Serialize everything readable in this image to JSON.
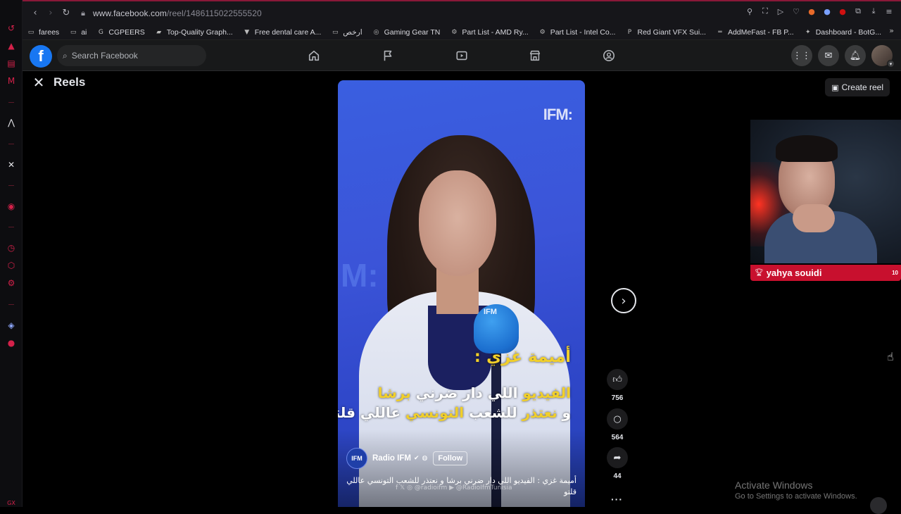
{
  "browser": {
    "url_host": "www.facebook.com",
    "url_path": "/reel/1486115022555520",
    "bookmarks": [
      {
        "icon": "folder-icon",
        "label": "farees"
      },
      {
        "icon": "folder-icon",
        "label": "ai"
      },
      {
        "icon": "cgpeers-icon",
        "label": "CGPEERS"
      },
      {
        "icon": "graphics-icon",
        "label": "Top-Quality Graph..."
      },
      {
        "icon": "dental-icon",
        "label": "Free dental care A..."
      },
      {
        "icon": "folder-icon",
        "label": "ارخص"
      },
      {
        "icon": "gaming-gear-icon",
        "label": "Gaming Gear TN"
      },
      {
        "icon": "partlist-icon",
        "label": "Part List - AMD Ry..."
      },
      {
        "icon": "partlist-icon",
        "label": "Part List - Intel Co..."
      },
      {
        "icon": "redgiant-icon",
        "label": "Red Giant VFX Sui..."
      },
      {
        "icon": "addmefast-icon",
        "label": "AddMeFast - FB P..."
      },
      {
        "icon": "botghost-icon",
        "label": "Dashboard - BotG..."
      }
    ]
  },
  "facebook": {
    "search_placeholder": "Search Facebook",
    "nav": [
      "home-icon",
      "flag-icon",
      "video-icon",
      "marketplace-icon",
      "groups-icon"
    ]
  },
  "reels": {
    "title": "Reels",
    "create_label": "Create reel"
  },
  "video": {
    "brand": "IFM:",
    "mic_label": "IFM",
    "caption_name": "أميمة غزي :",
    "caption_line1_a": "الفيديو",
    "caption_line1_b": " اللي دار ضرني ",
    "caption_line1_c": "برشا",
    "caption_line2_a": "و ",
    "caption_line2_b": "نعتذر",
    "caption_line2_c": " للشعب ",
    "caption_line2_d": "التونسي",
    "caption_line2_e": " عاللي قلتو",
    "author_avatar": "IFM",
    "author": "Radio IFM",
    "follow_label": "Follow",
    "description_1": "أميمة غزي : الفيديو اللي دار ضرني برشا و نعتذر للشعب التونسي عاللي",
    "description_2": "قلتو",
    "socials": "f  𝕏  ◎ @radioifm  ▶ @RadioIfmTunisia"
  },
  "actions": {
    "likes": "756",
    "comments": "564",
    "shares": "44"
  },
  "webcam": {
    "streamer": "yahya souidi",
    "counter": "10"
  },
  "watermark": {
    "line1": "Activate Windows",
    "line2": "Go to Settings to activate Windows."
  }
}
